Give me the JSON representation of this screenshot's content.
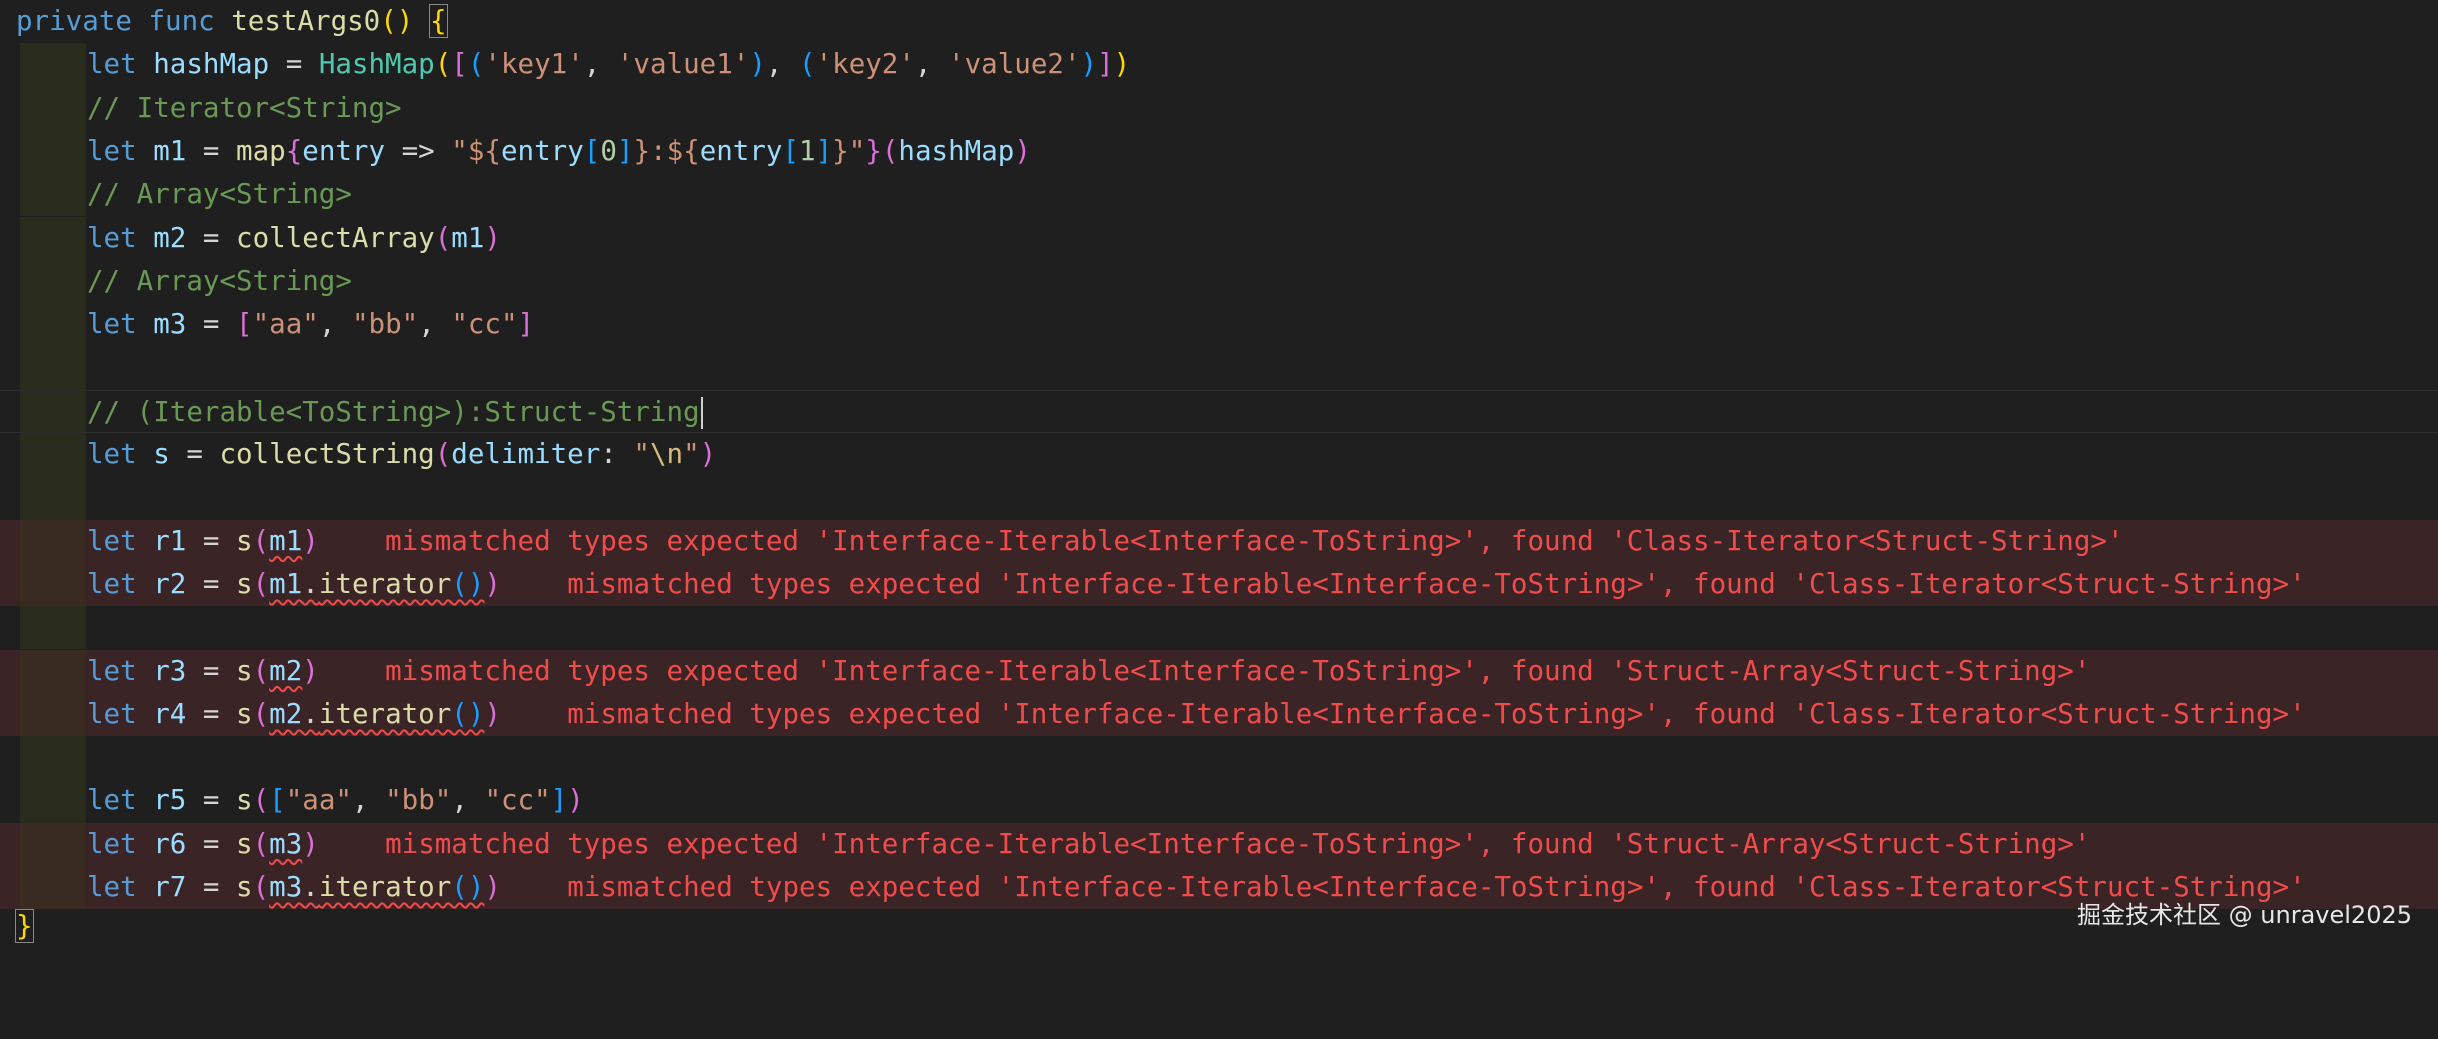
{
  "code": {
    "header": "private func testArgs0() {",
    "l1_var": "hashMap",
    "l1_type": "HashMap",
    "l1_k1": "'key1'",
    "l1_v1": "'value1'",
    "l1_k2": "'key2'",
    "l1_v2": "'value2'",
    "c1": "// Iterator<String>",
    "l2_var": "m1",
    "l2_fn": "map",
    "l2_param": "entry",
    "l2_str_open": "\"${",
    "l2_str_mid": ":${",
    "l2_str_close": "}\"",
    "l2_arg": "hashMap",
    "c2": "// Array<String>",
    "l3_var": "m2",
    "l3_fn": "collectArray",
    "l3_arg": "m1",
    "c3": "// Array<String>",
    "l4_var": "m3",
    "s_aa": "\"aa\"",
    "s_bb": "\"bb\"",
    "s_cc": "\"cc\"",
    "c4": "// (Iterable<ToString>):Struct-String",
    "l5_var": "s",
    "l5_fn": "collectString",
    "l5_param": "delimiter",
    "l5_str_escape": "\\n",
    "r1": "r1",
    "r2": "r2",
    "r3": "r3",
    "r4": "r4",
    "r5": "r5",
    "r6": "r6",
    "r7": "r7",
    "iter_fn": "iterator",
    "closing": "}"
  },
  "errors": {
    "r1": "mismatched types expected 'Interface-Iterable<Interface-ToString>', found 'Class-Iterator<Struct-String>'",
    "r2": "mismatched types expected 'Interface-Iterable<Interface-ToString>', found 'Class-Iterator<Struct-String>'",
    "r3": "mismatched types expected 'Interface-Iterable<Interface-ToString>', found 'Struct-Array<Struct-String>'",
    "r4": "mismatched types expected 'Interface-Iterable<Interface-ToString>', found 'Class-Iterator<Struct-String>'",
    "r6": "mismatched types expected 'Interface-Iterable<Interface-ToString>', found 'Struct-Array<Struct-String>'",
    "r7": "mismatched types expected 'Interface-Iterable<Interface-ToString>', found 'Class-Iterator<Struct-String>'"
  },
  "watermark": "掘金技术社区 @ unravel2025"
}
